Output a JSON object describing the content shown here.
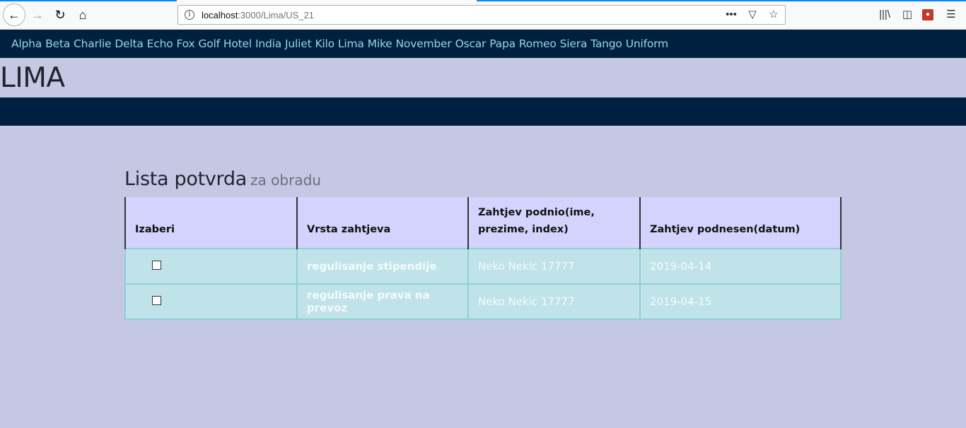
{
  "browser": {
    "url_host": "localhost",
    "url_path": ":3000/Lima/US_21",
    "icons": [
      "back-icon",
      "forward-icon",
      "reload-icon",
      "home-icon",
      "info-icon",
      "more-icon",
      "pocket-icon",
      "bookmark-star-icon",
      "library-icon",
      "sidebar-icon",
      "extension-icon",
      "menu-icon"
    ]
  },
  "nav": {
    "links": [
      "Alpha",
      "Beta",
      "Charlie",
      "Delta",
      "Echo",
      "Fox",
      "Golf",
      "Hotel",
      "India",
      "Juliet",
      "Kilo",
      "Lima",
      "Mike",
      "November",
      "Oscar",
      "Papa",
      "Romeo",
      "Siera",
      "Tango",
      "Uniform"
    ]
  },
  "page": {
    "heading": "LIMA",
    "section_title": "Lista potvrda",
    "section_subtitle": "za obradu"
  },
  "table": {
    "headers": [
      "Izaberi",
      "Vrsta zahtjeva",
      "Zahtjev podnio(ime, prezime, index)",
      "Zahtjev podnesen(datum)"
    ],
    "rows": [
      {
        "checked": false,
        "type": "regulisanje stipendije",
        "submitter": "Neko Nekic 17777",
        "date": "2019-04-14"
      },
      {
        "checked": false,
        "type": "regulisanje prava na prevoz",
        "submitter": "Neko Nekic 17777",
        "date": "2019-04-15"
      }
    ]
  },
  "colors": {
    "page_bg": "#c5c8e2",
    "navbar_bg": "#002040",
    "nav_link": "#9ad4e3",
    "header_bg": "#d3d3fe",
    "row_bg": "#bfe3e9"
  }
}
